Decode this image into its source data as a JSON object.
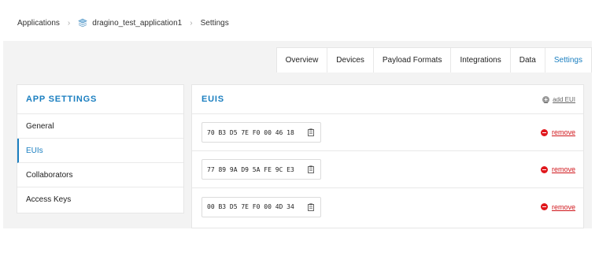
{
  "breadcrumb": {
    "root": "Applications",
    "application": "dragino_test_application1",
    "current": "Settings"
  },
  "tabs": [
    {
      "label": "Overview",
      "active": false
    },
    {
      "label": "Devices",
      "active": false
    },
    {
      "label": "Payload Formats",
      "active": false
    },
    {
      "label": "Integrations",
      "active": false
    },
    {
      "label": "Data",
      "active": false
    },
    {
      "label": "Settings",
      "active": true
    }
  ],
  "sidebar": {
    "title": "APP SETTINGS",
    "items": [
      {
        "label": "General",
        "active": false
      },
      {
        "label": "EUIs",
        "active": true
      },
      {
        "label": "Collaborators",
        "active": false
      },
      {
        "label": "Access Keys",
        "active": false
      }
    ]
  },
  "main": {
    "title": "EUIS",
    "add_label": "add EUI",
    "remove_label": "remove",
    "euis": [
      "70 B3 D5 7E F0 00 46 18",
      "77 89 9A D9 5A FE 9C E3",
      "00 B3 D5 7E F0 00 4D 34"
    ]
  },
  "colors": {
    "accent": "#1b7fc0",
    "danger": "#e0171c",
    "background": "#f3f3f3"
  },
  "icons": {
    "breadcrumb_separator": "chevron-right-icon",
    "application": "layers-icon",
    "copy": "clipboard-icon",
    "add": "plus-circle-icon",
    "remove": "minus-circle-icon"
  }
}
